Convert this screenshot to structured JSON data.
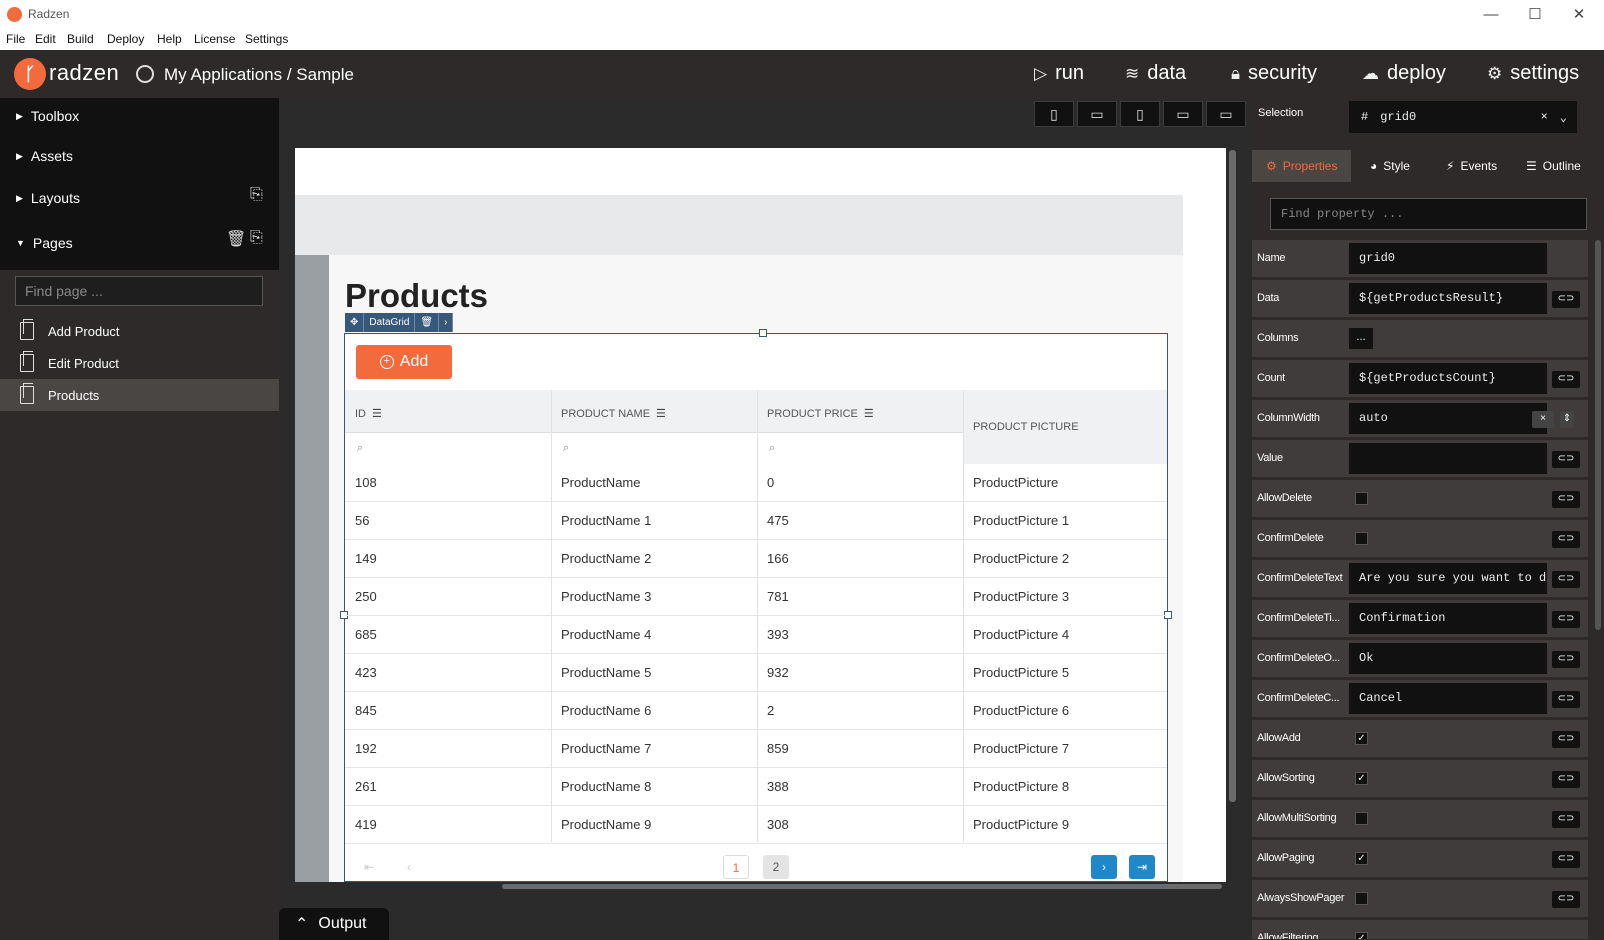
{
  "window": {
    "title": "Radzen",
    "minimize": "—",
    "maximize": "☐",
    "close": "✕"
  },
  "menu": [
    "File",
    "Edit",
    "Build",
    "Deploy",
    "Help",
    "License",
    "Settings"
  ],
  "header": {
    "brand": "radzen",
    "breadcrumb": "My Applications / Sample",
    "nav": [
      {
        "label": "run",
        "icon": "play-icon"
      },
      {
        "label": "data",
        "icon": "layers-icon"
      },
      {
        "label": "security",
        "icon": "lock-icon"
      },
      {
        "label": "deploy",
        "icon": "cloud-upload-icon"
      },
      {
        "label": "settings",
        "icon": "gear-icon"
      }
    ]
  },
  "sidebar": {
    "sections": [
      "Toolbox",
      "Assets",
      "Layouts",
      "Pages"
    ],
    "find_placeholder": "Find page ...",
    "pages": [
      "Add Product",
      "Edit Product",
      "Products"
    ],
    "selected_page": "Products"
  },
  "canvas": {
    "page_title": "Products",
    "component_tag": "DataGrid",
    "add_button": "Add",
    "columns": [
      "ID",
      "PRODUCT NAME",
      "PRODUCT PRICE",
      "PRODUCT PICTURE"
    ],
    "rows": [
      [
        "108",
        "ProductName",
        "0",
        "ProductPicture"
      ],
      [
        "56",
        "ProductName 1",
        "475",
        "ProductPicture 1"
      ],
      [
        "149",
        "ProductName 2",
        "166",
        "ProductPicture 2"
      ],
      [
        "250",
        "ProductName 3",
        "781",
        "ProductPicture 3"
      ],
      [
        "685",
        "ProductName 4",
        "393",
        "ProductPicture 4"
      ],
      [
        "423",
        "ProductName 5",
        "932",
        "ProductPicture 5"
      ],
      [
        "845",
        "ProductName 6",
        "2",
        "ProductPicture 6"
      ],
      [
        "192",
        "ProductName 7",
        "859",
        "ProductPicture 7"
      ],
      [
        "261",
        "ProductName 8",
        "388",
        "ProductPicture 8"
      ],
      [
        "419",
        "ProductName 9",
        "308",
        "ProductPicture 9"
      ]
    ],
    "pages": [
      "1",
      "2"
    ],
    "current_page": "1"
  },
  "output": {
    "label": "Output"
  },
  "right_panel": {
    "selection_label": "Selection",
    "selection_value": "grid0",
    "tabs": [
      "Properties",
      "Style",
      "Events",
      "Outline"
    ],
    "active_tab": "Properties",
    "find_placeholder": "Find property ...",
    "properties": [
      {
        "name": "Name",
        "value": "grid0",
        "type": "text"
      },
      {
        "name": "Data",
        "value": "${getProductsResult}",
        "type": "text"
      },
      {
        "name": "Columns",
        "value": "...",
        "type": "dots"
      },
      {
        "name": "Count",
        "value": "${getProductsCount}",
        "type": "text"
      },
      {
        "name": "ColumnWidth",
        "value": "auto",
        "type": "text"
      },
      {
        "name": "Value",
        "value": "",
        "type": "text"
      },
      {
        "name": "AllowDelete",
        "value": false,
        "type": "check"
      },
      {
        "name": "ConfirmDelete",
        "value": false,
        "type": "check"
      },
      {
        "name": "ConfirmDeleteText",
        "value": "Are you sure you want to de",
        "type": "text"
      },
      {
        "name": "ConfirmDeleteTi...",
        "value": "Confirmation",
        "type": "text"
      },
      {
        "name": "ConfirmDeleteO...",
        "value": "Ok",
        "type": "text"
      },
      {
        "name": "ConfirmDeleteC...",
        "value": "Cancel",
        "type": "text"
      },
      {
        "name": "AllowAdd",
        "value": true,
        "type": "check"
      },
      {
        "name": "AllowSorting",
        "value": true,
        "type": "check"
      },
      {
        "name": "AllowMultiSorting",
        "value": false,
        "type": "check"
      },
      {
        "name": "AllowPaging",
        "value": true,
        "type": "check"
      },
      {
        "name": "AlwaysShowPager",
        "value": false,
        "type": "check"
      },
      {
        "name": "AllowFiltering",
        "value": true,
        "type": "check"
      }
    ]
  },
  "colors": {
    "accent": "#f36a3d",
    "dark": "#2d2a29",
    "selection": "#36587a",
    "pager_blue": "#1e88c8"
  }
}
